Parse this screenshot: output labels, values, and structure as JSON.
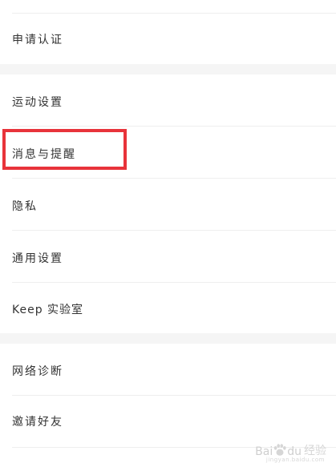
{
  "menu": {
    "group1": {
      "apply_cert": "申请认证"
    },
    "group2": {
      "sport_settings": "运动设置",
      "messages_reminders": "消息与提醒",
      "privacy": "隐私",
      "general_settings": "通用设置",
      "keep_lab": "Keep 实验室"
    },
    "group3": {
      "network_diagnosis": "网络诊断",
      "invite_friends": "邀请好友"
    }
  },
  "watermark": {
    "brand": "Bai",
    "brand_suffix": "du",
    "cn": "经验",
    "sub": "jingyan.baidu.com"
  },
  "colors": {
    "highlight": "#e8333a",
    "section_gap": "#f5f5f5",
    "text": "#333333"
  }
}
